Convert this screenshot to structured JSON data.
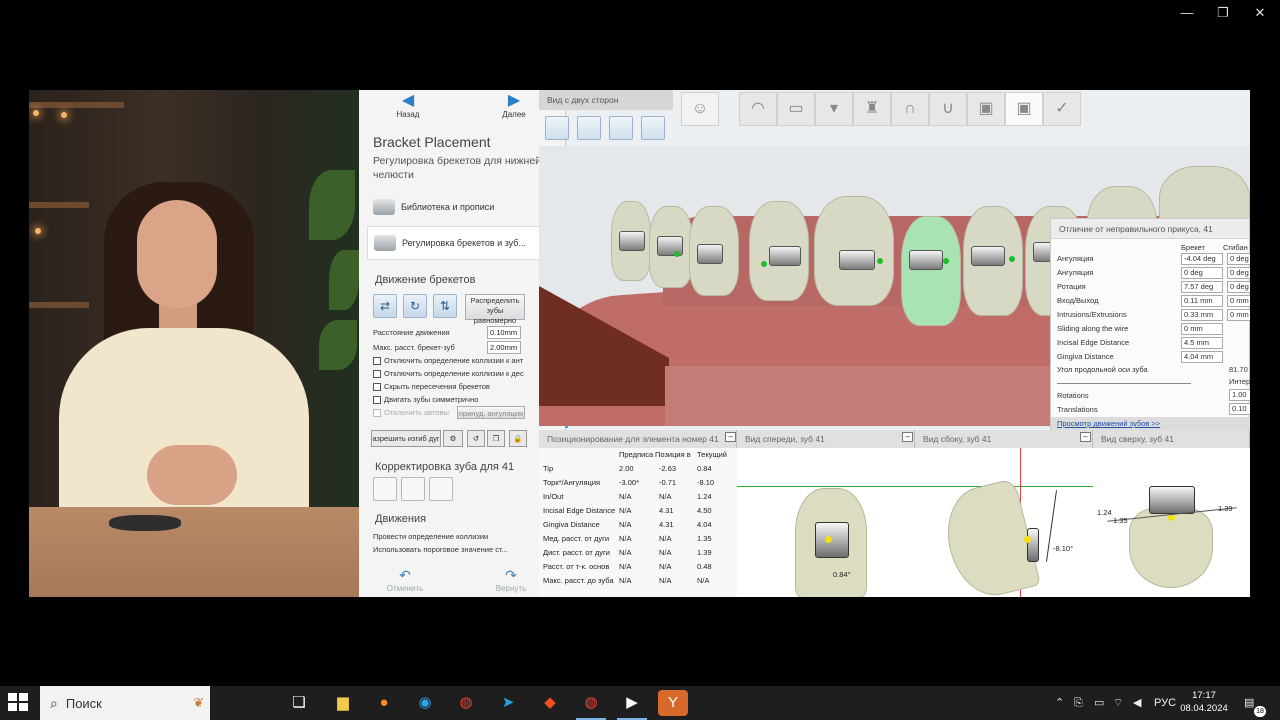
{
  "window": {
    "minimize": "—",
    "restore": "❐",
    "close": "✕"
  },
  "left_panel": {
    "back": "Назад",
    "next": "Далее",
    "title": "Bracket Placement",
    "subtitle": "Регулировка брекетов для нижней челюсти",
    "library": "Библиотека и прописи",
    "adjust": "Регулировка брекетов и зуб...",
    "movement_header": "Движение брекетов",
    "distribute": "Распределить зубы равномерно",
    "move_distance_label": "Расстояние движения",
    "move_distance_value": "0.10mm",
    "max_dist_label": "Макс. расст. брекет-зуб",
    "max_dist_value": "2.00mm",
    "checks": [
      "Отключить определение коллизии к ант",
      "Отключить определение коллизии к дес",
      "Скрыть пересечения брекетов",
      "Двигать зубы симметрично",
      "Отключить автовы"
    ],
    "angulation_btn": "принуд. ангуляция",
    "arch_btn": "азрешить изгиб дуг",
    "tooth_correction_header": "Корректировка зуба для 41",
    "motions_header": "Движения",
    "collision_check": "Провести определение коллизии",
    "threshold_check": "Использовать пороговое значение ст...",
    "undo": "Отменить",
    "redo": "Вернуть"
  },
  "toolbar": {
    "view_two_sides": "Вид с двух сторон"
  },
  "bite": {
    "title": "Отличие от неправильного прикуса, 41",
    "col_bracket": "Брекет",
    "col_shift": "Сгибан",
    "rows": [
      {
        "label": "Ангуляция",
        "v1": "-4.04 deg",
        "v2": "0 deg"
      },
      {
        "label": "Ангуляция",
        "v1": "0 deg",
        "v2": "0 deg"
      },
      {
        "label": "Ротация",
        "v1": "7.57 deg",
        "v2": "0 deg"
      },
      {
        "label": "Вход/Выход",
        "v1": "0.11 mm",
        "v2": "0 mm"
      },
      {
        "label": "Intrusions/Extrusions",
        "v1": "0.33 mm",
        "v2": "0 mm"
      },
      {
        "label": "Sliding along the wire",
        "v1": "0 mm",
        "v2": ""
      },
      {
        "label": "Incisal Edge Distance",
        "v1": "4.5 mm",
        "v2": ""
      },
      {
        "label": "Gingiva Distance",
        "v1": "4.04 mm",
        "v2": ""
      }
    ],
    "long_axis_label": "Угол продольной оси зуба",
    "long_axis_value": "81.70",
    "inter_label": "Интер",
    "rotations_label": "Rotations",
    "rotations_value": "1.00",
    "translations_label": "Translations",
    "translations_value": "0.10",
    "link": "Просмотр движений зубов >>"
  },
  "positioning": {
    "title": "Позиционирование для элемента номер 41",
    "headers": [
      "Предписан",
      "Позиция в",
      "Текущий"
    ],
    "rows": [
      {
        "label": "Tip",
        "a": "2.00",
        "b": "-2.63",
        "c": "0.84"
      },
      {
        "label": "Торк*/Ангуляция",
        "a": "-3.00*",
        "b": "-0.71",
        "c": "-8.10"
      },
      {
        "label": "In/Out",
        "a": "N/A",
        "b": "N/A",
        "c": "1.24"
      },
      {
        "label": "Incisal Edge Distance",
        "a": "N/A",
        "b": "4.31",
        "c": "4.50"
      },
      {
        "label": "Gingiva Distance",
        "a": "N/A",
        "b": "4.31",
        "c": "4.04"
      },
      {
        "label": "Мед. расст. от дуги",
        "a": "N/A",
        "b": "N/A",
        "c": "1.35"
      },
      {
        "label": "Дист. расст. от дуги",
        "a": "N/A",
        "b": "N/A",
        "c": "1.39"
      },
      {
        "label": "Расст. от т-к. основ",
        "a": "N/A",
        "b": "N/A",
        "c": "0.48"
      },
      {
        "label": "Макс. расст. до зуба",
        "a": "N/A",
        "b": "N/A",
        "c": "N/A"
      }
    ]
  },
  "views": {
    "front": "Вид спереди, зуб 41",
    "side": "Вид сбоку, зуб 41",
    "top": "Вид сверху, зуб 41",
    "front_angle": "0.84°",
    "side_angle": "-8.10°",
    "top_left1": "1.24",
    "top_left2": "1.35",
    "top_right": "1.39"
  },
  "taskbar": {
    "search_placeholder": "Поиск",
    "lang": "РУС",
    "time": "17:17",
    "date": "08.04.2024",
    "notifications": "18"
  },
  "colors": {
    "accent": "#2b7fc4",
    "gum": "#c06c68",
    "tooth": "#d8d9c4",
    "highlight_tooth": "#a9e3b4"
  }
}
